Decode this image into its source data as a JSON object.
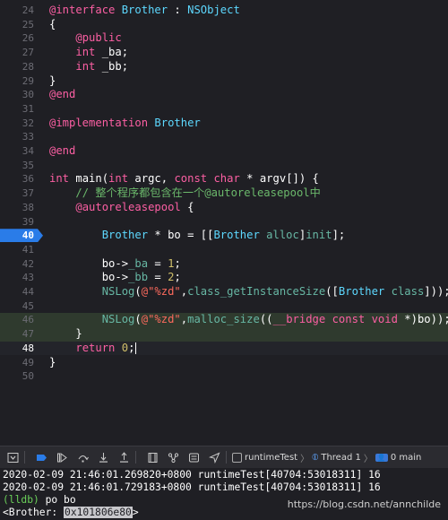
{
  "editor": {
    "lines": [
      {
        "n": "24",
        "tokens": [
          [
            "kw",
            "@interface"
          ],
          [
            "plain",
            " "
          ],
          [
            "cls",
            "Brother"
          ],
          [
            "plain",
            " : "
          ],
          [
            "cls",
            "NSObject"
          ]
        ]
      },
      {
        "n": "25",
        "tokens": [
          [
            "plain",
            "{"
          ]
        ]
      },
      {
        "n": "26",
        "tokens": [
          [
            "plain",
            "    "
          ],
          [
            "kw",
            "@public"
          ]
        ]
      },
      {
        "n": "27",
        "tokens": [
          [
            "plain",
            "    "
          ],
          [
            "kw",
            "int"
          ],
          [
            "plain",
            " _ba;"
          ]
        ]
      },
      {
        "n": "28",
        "tokens": [
          [
            "plain",
            "    "
          ],
          [
            "kw",
            "int"
          ],
          [
            "plain",
            " _bb;"
          ]
        ]
      },
      {
        "n": "29",
        "tokens": [
          [
            "plain",
            "}"
          ]
        ]
      },
      {
        "n": "30",
        "tokens": [
          [
            "kw",
            "@end"
          ]
        ]
      },
      {
        "n": "31",
        "tokens": []
      },
      {
        "n": "32",
        "tokens": [
          [
            "kw",
            "@implementation"
          ],
          [
            "plain",
            " "
          ],
          [
            "cls",
            "Brother"
          ]
        ]
      },
      {
        "n": "33",
        "tokens": []
      },
      {
        "n": "34",
        "tokens": [
          [
            "kw",
            "@end"
          ]
        ]
      },
      {
        "n": "35",
        "tokens": []
      },
      {
        "n": "36",
        "tokens": [
          [
            "kw",
            "int"
          ],
          [
            "plain",
            " "
          ],
          [
            "plain",
            "main("
          ],
          [
            "kw",
            "int"
          ],
          [
            "plain",
            " argc, "
          ],
          [
            "kw",
            "const"
          ],
          [
            "plain",
            " "
          ],
          [
            "kw",
            "char"
          ],
          [
            "plain",
            " * argv[]) {"
          ]
        ]
      },
      {
        "n": "37",
        "tokens": [
          [
            "plain",
            "    "
          ],
          [
            "cmt",
            "// 整个程序都包含在一个@autoreleasepool中"
          ]
        ]
      },
      {
        "n": "38",
        "tokens": [
          [
            "plain",
            "    "
          ],
          [
            "kw",
            "@autoreleasepool"
          ],
          [
            "plain",
            " {"
          ]
        ]
      },
      {
        "n": "39",
        "tokens": []
      },
      {
        "n": "40",
        "tokens": [
          [
            "plain",
            "        "
          ],
          [
            "cls",
            "Brother"
          ],
          [
            "plain",
            " * bo = [["
          ],
          [
            "cls",
            "Brother"
          ],
          [
            "plain",
            " "
          ],
          [
            "fn",
            "alloc"
          ],
          [
            "plain",
            "]"
          ],
          [
            "fn",
            "init"
          ],
          [
            "plain",
            "];"
          ]
        ]
      },
      {
        "n": "41",
        "tokens": []
      },
      {
        "n": "42",
        "tokens": [
          [
            "plain",
            "        bo->"
          ],
          [
            "fn",
            "_ba"
          ],
          [
            "plain",
            " = "
          ],
          [
            "num",
            "1"
          ],
          [
            "plain",
            ";"
          ]
        ]
      },
      {
        "n": "43",
        "tokens": [
          [
            "plain",
            "        bo->"
          ],
          [
            "fn",
            "_bb"
          ],
          [
            "plain",
            " = "
          ],
          [
            "num",
            "2"
          ],
          [
            "plain",
            ";"
          ]
        ]
      },
      {
        "n": "44",
        "tokens": [
          [
            "plain",
            "        "
          ],
          [
            "fn",
            "NSLog"
          ],
          [
            "plain",
            "("
          ],
          [
            "str",
            "@\"%zd\""
          ],
          [
            "plain",
            ","
          ],
          [
            "fn",
            "class_getInstanceSize"
          ],
          [
            "plain",
            "(["
          ],
          [
            "cls",
            "Brother"
          ],
          [
            "plain",
            " "
          ],
          [
            "fn",
            "class"
          ],
          [
            "plain",
            "]));"
          ]
        ]
      },
      {
        "n": "45",
        "tokens": []
      },
      {
        "n": "46",
        "tokens": [
          [
            "plain",
            "        "
          ],
          [
            "fn",
            "NSLog"
          ],
          [
            "plain",
            "("
          ],
          [
            "str",
            "@\"%zd\""
          ],
          [
            "plain",
            ","
          ],
          [
            "fn",
            "malloc_size"
          ],
          [
            "plain",
            "(("
          ],
          [
            "kw",
            "__bridge"
          ],
          [
            "plain",
            " "
          ],
          [
            "kw",
            "const"
          ],
          [
            "plain",
            " "
          ],
          [
            "kw",
            "void"
          ],
          [
            "plain",
            " *)bo));"
          ]
        ]
      },
      {
        "n": "47",
        "tokens": [
          [
            "plain",
            "    }"
          ]
        ]
      },
      {
        "n": "48",
        "tokens": [
          [
            "plain",
            "    "
          ],
          [
            "kw",
            "return"
          ],
          [
            "plain",
            " "
          ],
          [
            "num",
            "0"
          ],
          [
            "plain",
            ";"
          ]
        ]
      },
      {
        "n": "49",
        "tokens": [
          [
            "plain",
            "}"
          ]
        ]
      },
      {
        "n": "50",
        "tokens": []
      }
    ],
    "breakpoint_line": "40",
    "current_line": "48"
  },
  "debugbar": {
    "crumbs": [
      "runtimeTest",
      "Thread 1",
      "0 main"
    ]
  },
  "console": {
    "log1": "2020-02-09 21:46:01.269820+0800 runtimeTest[40704:53018311] 16",
    "log2": "2020-02-09 21:46:01.729183+0800 runtimeTest[40704:53018311] 16",
    "prompt": "(lldb)",
    "command": " po bo",
    "result_prefix": "<Brother: ",
    "result_addr": "0x101806e80",
    "result_suffix": ">"
  },
  "watermark": "https://blog.csdn.net/annchilde"
}
